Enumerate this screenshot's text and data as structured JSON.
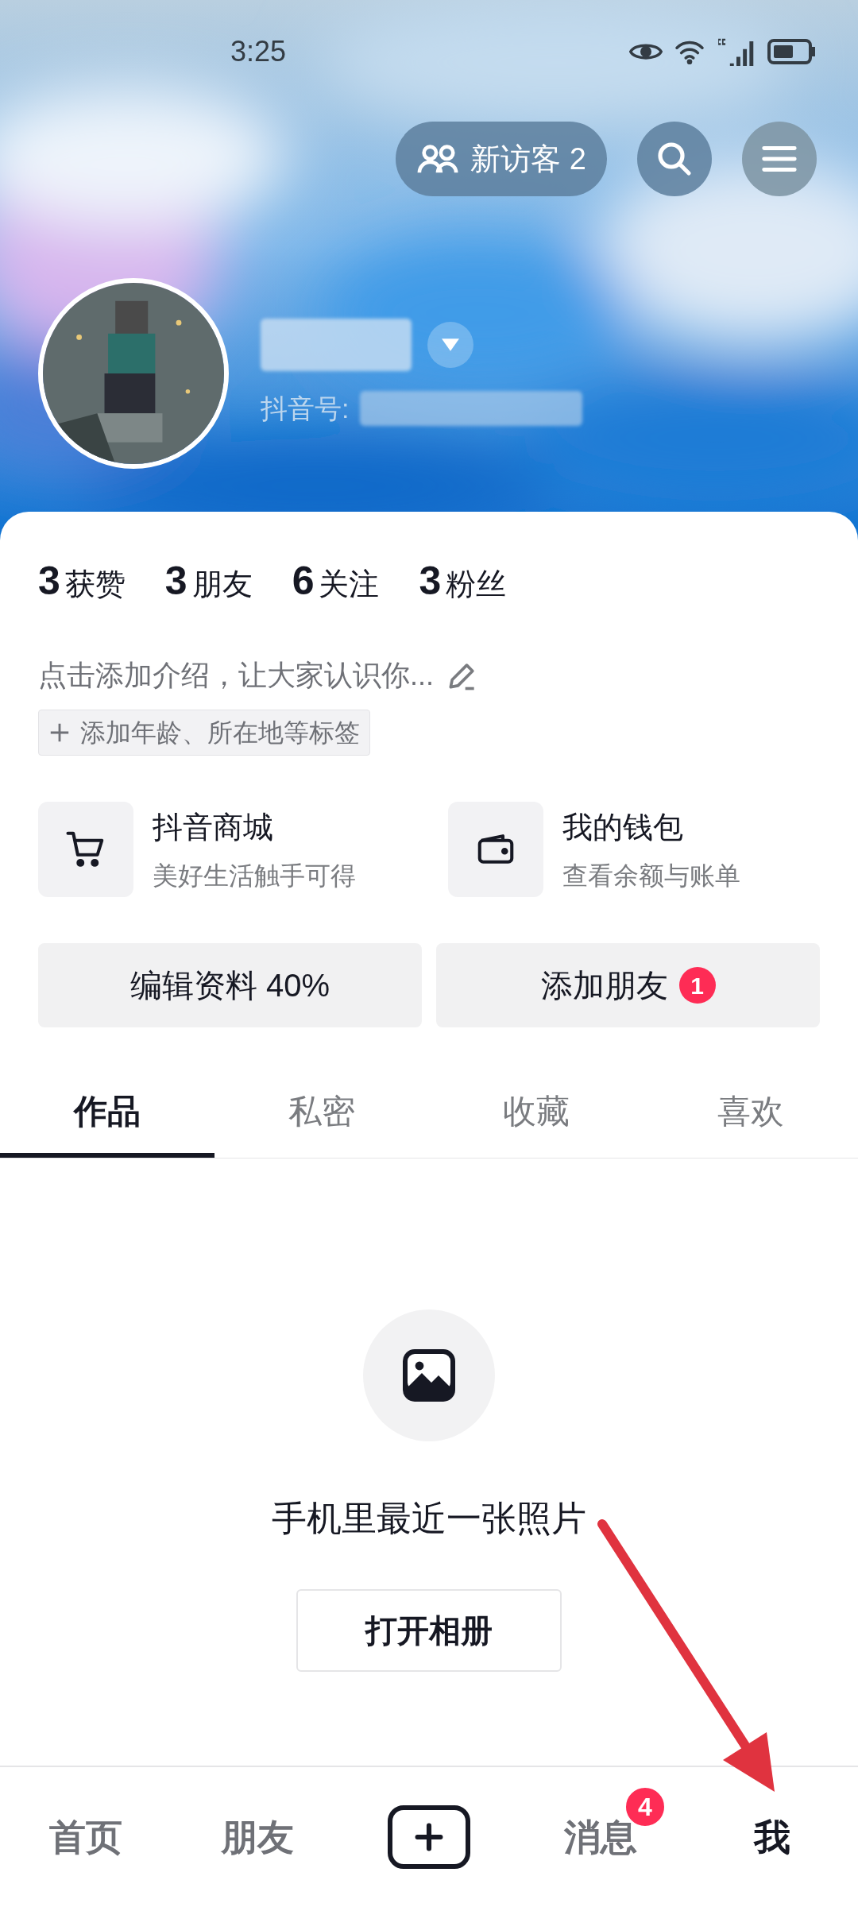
{
  "status_bar": {
    "time": "3:25"
  },
  "header": {
    "visitors_button": "新访客 2",
    "id_label": "抖音号:"
  },
  "stats": [
    "**3**获赞",
    "**3**朋友",
    "**6**关注",
    "**3**粉丝"
  ],
  "bio_placeholder": "点击添加介绍，让大家认识你...",
  "tag_button": "添加年龄、所在地等标签",
  "services": [
    {
      "kind": "cart",
      "title": "抖音商城",
      "subtitle": "美好生活触手可得"
    },
    {
      "kind": "wallet",
      "title": "我的钱包",
      "subtitle": "查看余额与账单"
    }
  ],
  "actions": [
    {
      "label": "编辑资料 40%"
    },
    {
      "label": "添加朋友",
      "badge": "1"
    }
  ],
  "tabs": [
    {
      "label": "作品",
      "selected": true
    },
    {
      "label": "私密",
      "selected": false
    },
    {
      "label": "收藏",
      "selected": false
    },
    {
      "label": "喜欢",
      "selected": false
    }
  ],
  "empty_state": {
    "message": "手机里最近一张照片",
    "button": "打开相册"
  },
  "bottom_nav": [
    {
      "kind": "text",
      "label": "首页",
      "selected": false
    },
    {
      "kind": "text",
      "label": "朋友",
      "selected": false
    },
    {
      "kind": "create",
      "selected": false
    },
    {
      "kind": "text",
      "label": "消息",
      "selected": false,
      "badge": "4"
    },
    {
      "kind": "text",
      "label": "我",
      "selected": true
    }
  ]
}
